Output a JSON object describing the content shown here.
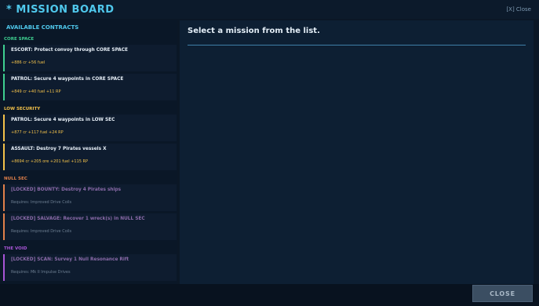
{
  "window": {
    "title": "* MISSION BOARD",
    "close_link": "[X] Close"
  },
  "contracts": {
    "heading": "AVAILABLE CONTRACTS",
    "groups": [
      {
        "label": "CORE SPACE",
        "color": "#3ecf90",
        "missions": [
          {
            "title": "ESCORT: Protect convoy through CORE SPACE",
            "reward": "+886 cr  +56 fuel"
          },
          {
            "title": "PATROL: Secure 4 waypoints in CORE SPACE",
            "reward": "+849 cr  +40 fuel  +11 RP"
          }
        ]
      },
      {
        "label": "LOW SECURITY",
        "color": "#f2c14a",
        "missions": [
          {
            "title": "PATROL: Secure 4 waypoints in LOW SEC",
            "reward": "+877 cr  +117 fuel  +24 RP"
          },
          {
            "title": "ASSAULT: Destroy 7 Pirates vessels  X",
            "reward": "+8694 cr  +205 ore  +201 fuel  +115 RP"
          }
        ]
      },
      {
        "label": "NULL SEC",
        "color": "#e0804a",
        "missions": [
          {
            "title": "[LOCKED] BOUNTY: Destroy 4 Pirates ships",
            "requires": "Requires: Improved Drive Coils"
          },
          {
            "title": "[LOCKED] SALVAGE: Recover 1 wreck(s) in NULL SEC",
            "requires": "Requires: Improved Drive Coils"
          }
        ]
      },
      {
        "label": "THE VOID",
        "color": "#a855d6",
        "missions": [
          {
            "title": "[LOCKED] SCAN: Survey 1 Null Resonance Rift",
            "requires": "Requires: Mk II Impulse Drives"
          }
        ]
      }
    ]
  },
  "detail": {
    "prompt": "Select a mission from the list."
  },
  "footer": {
    "close_button": "CLOSE"
  }
}
